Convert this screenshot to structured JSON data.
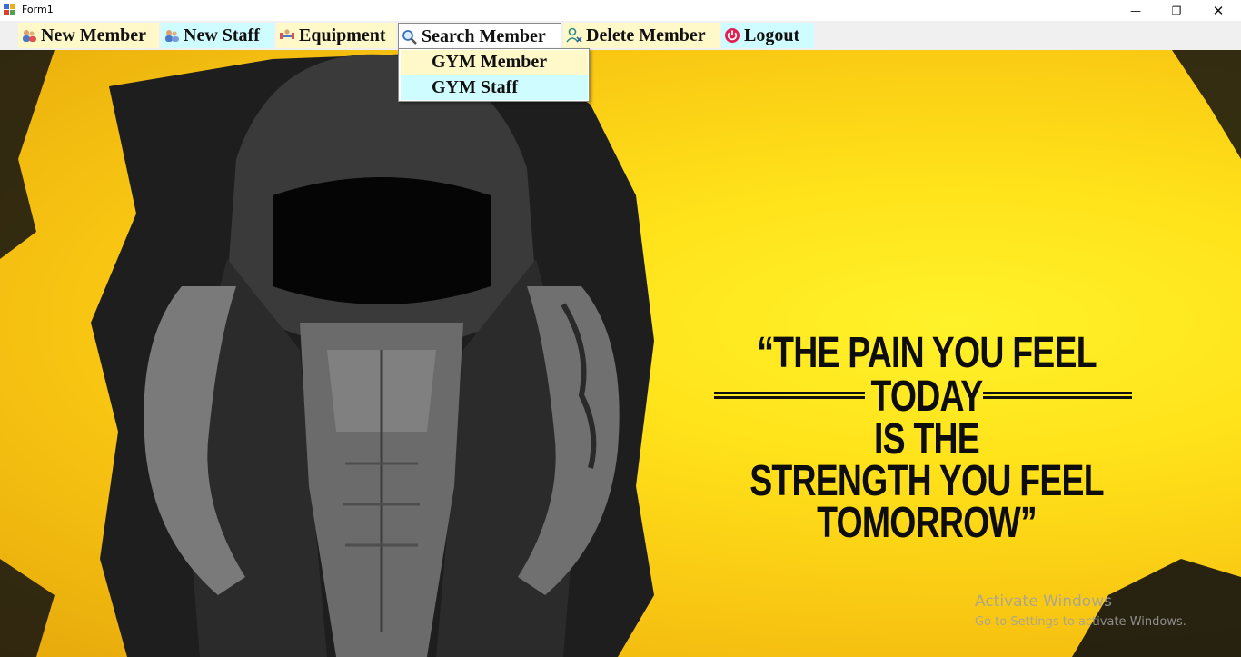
{
  "window": {
    "title": "Form1",
    "minimize_glyph": "—",
    "maximize_glyph": "❐",
    "close_glyph": "✕"
  },
  "menu": {
    "items": [
      {
        "label": "New Member",
        "icon": "users-icon",
        "bg": "#fff8c8"
      },
      {
        "label": "New Staff",
        "icon": "staff-icon",
        "bg": "#cffcff"
      },
      {
        "label": "Equipment",
        "icon": "dumbbell-icon",
        "bg": "#fff8c8"
      },
      {
        "label": "Search Member",
        "icon": "search-icon",
        "bg": "#ffffff"
      },
      {
        "label": "Delete Member",
        "icon": "delete-user-icon",
        "bg": "#fff8c8"
      },
      {
        "label": "Logout",
        "icon": "power-icon",
        "bg": "#cffcff"
      }
    ],
    "search_dropdown": [
      {
        "label": "GYM Member",
        "bg": "#fff8c8"
      },
      {
        "label": "GYM Staff",
        "bg": "#cffcff"
      }
    ]
  },
  "banner": {
    "quote_line1": "“THE PAIN YOU FEEL TODAY",
    "quote_line2": "IS THE",
    "quote_line3": "STRENGTH YOU FEEL TOMORROW”"
  },
  "watermark": {
    "line1": "Activate Windows",
    "line2": "Go to Settings to activate Windows."
  },
  "colors": {
    "yellow_light": "#fff8c8",
    "cyan_light": "#cffcff",
    "banner_yellow": "#ffe21a"
  }
}
